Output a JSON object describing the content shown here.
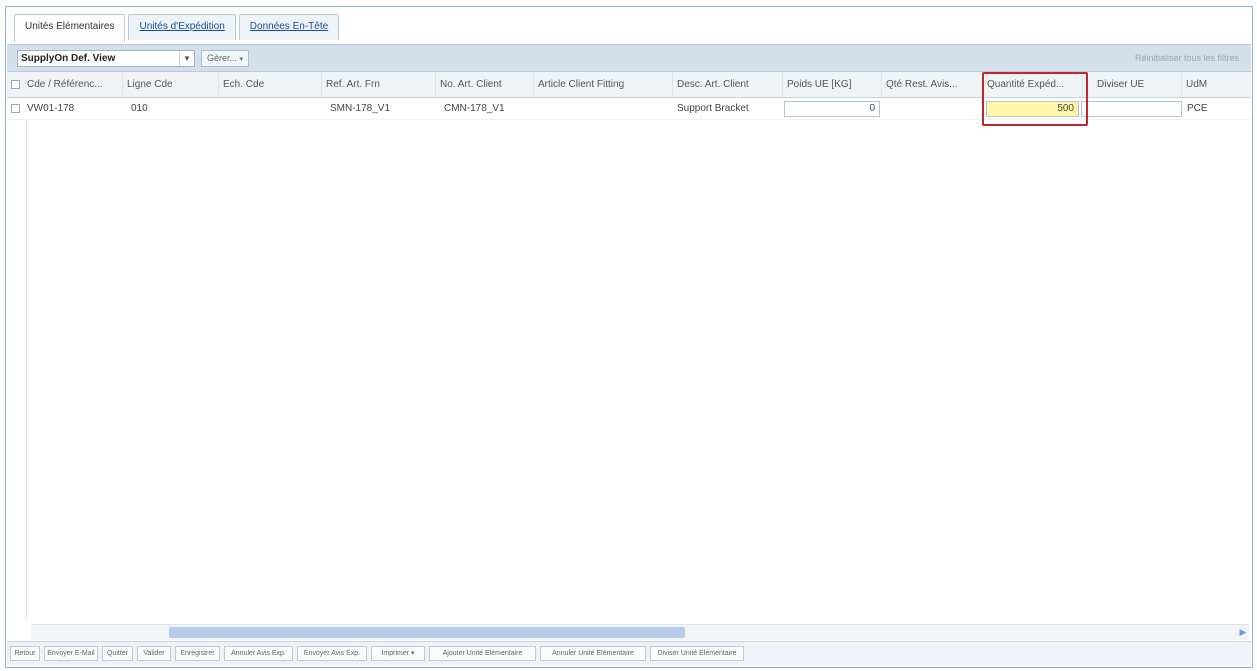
{
  "tabs": [
    {
      "label": "Unités Elémentaires",
      "active": true
    },
    {
      "label": "Unités d'Expédition",
      "active": false
    },
    {
      "label": "Données En-Tête",
      "active": false
    }
  ],
  "toolbar": {
    "view_select": "SupplyOn Def. View",
    "gerer_label": "Gérer...",
    "reset_filters": "Réinitialiser tous les filtres"
  },
  "grid": {
    "headers": {
      "cde_reference": "Cde / Référenc...",
      "ligne_cde": "Ligne Cde",
      "ech_cde": "Ech. Cde",
      "ref_art_frn": "Ref. Art. Frn",
      "no_art_client": "No. Art. Client",
      "article_client_fitting": "Article Client Fitting",
      "desc_art_client": "Desc. Art. Client",
      "poids_ue": "Poids UE [KG]",
      "qte_rest_avis": "Qté Rest. Avis...",
      "quantite_exped": "Quantité Expéd...",
      "diviser_ue": "Diviser UE",
      "udm": "UdM"
    },
    "row": {
      "cde_reference": "VW01-178",
      "ligne_cde": "010",
      "ech_cde": "",
      "ref_art_frn": "SMN-178_V1",
      "no_art_client": "CMN-178_V1",
      "article_client_fitting": "",
      "desc_art_client": "Support Bracket",
      "poids_ue": "0",
      "qte_rest_avis": "",
      "quantite_exped": "500",
      "diviser_ue": "",
      "udm": "PCE"
    }
  },
  "footer": {
    "retour": "Retour",
    "envoyer_email": "Envoyer E-Mail",
    "quitter": "Quitter",
    "valider": "Valider",
    "enregistrer": "Enregistrer",
    "annuler_avis": "Annuler Avis Exp.",
    "envoyer_avis": "Envoyer Avis Exp.",
    "imprimer": "Imprimer",
    "ajouter_ue": "Ajouter Unité Elémentaire",
    "annuler_ue": "Annuler Unité Elémentaire",
    "diviser_ue": "Diviser Unité Elémentaire"
  },
  "colors": {
    "highlight_border": "#c0272d",
    "editable_yellow": "#fff7a8",
    "toolbar_bg": "#d3dfea"
  }
}
